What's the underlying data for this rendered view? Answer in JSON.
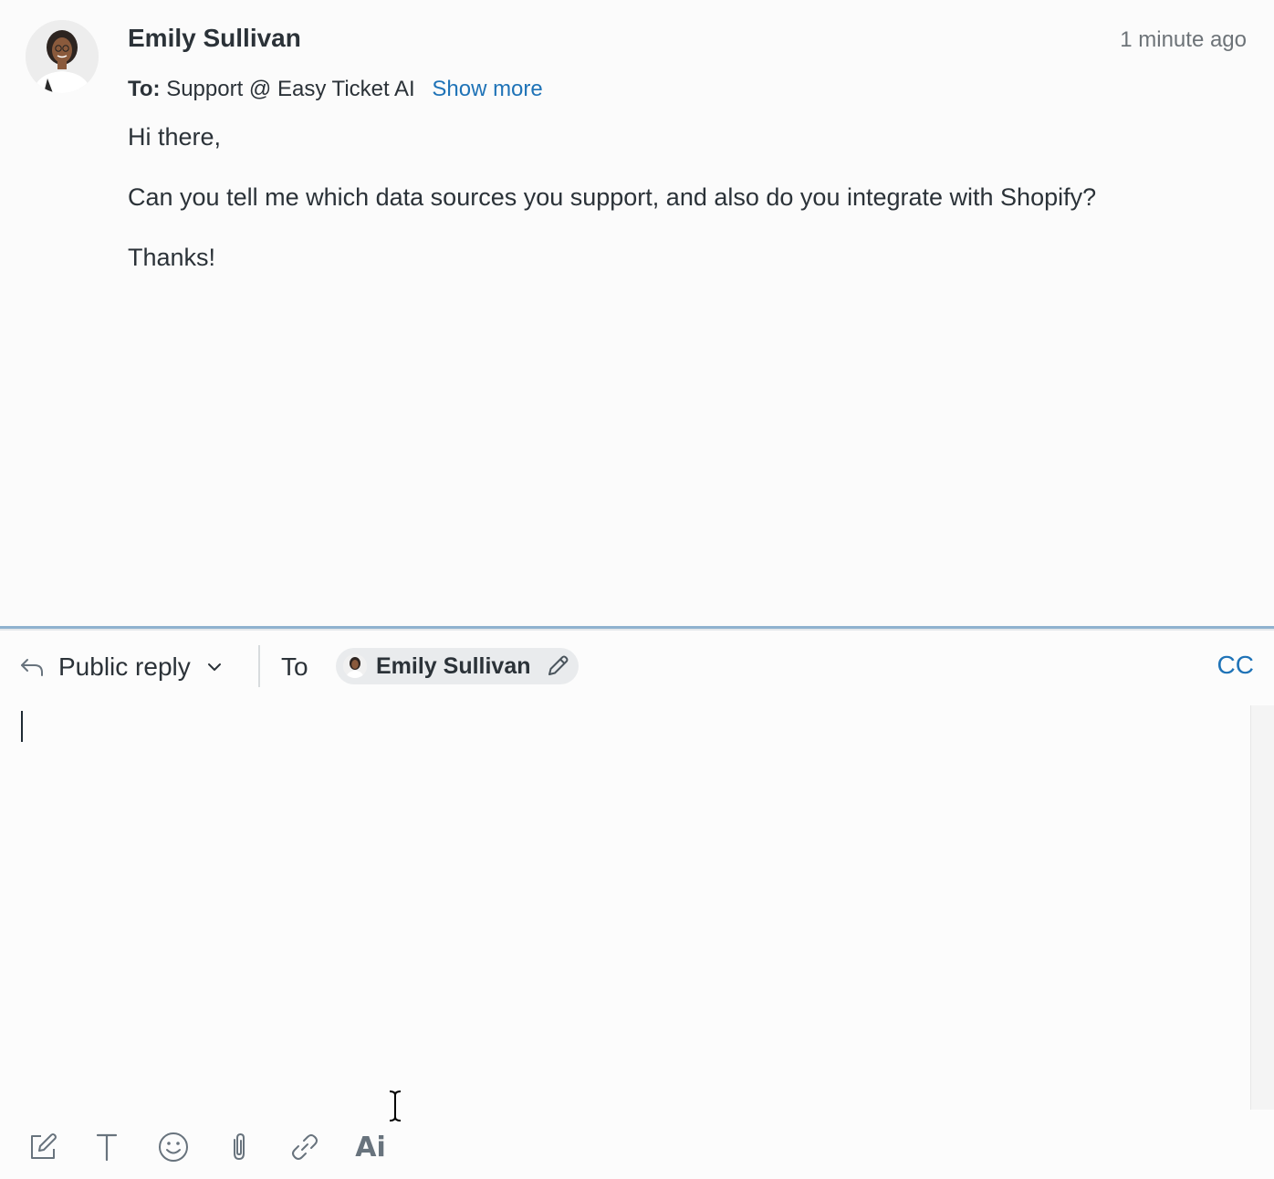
{
  "message": {
    "sender_name": "Emily Sullivan",
    "timestamp": "1 minute ago",
    "to_prefix": "To:",
    "to_value": "Support @ Easy Ticket AI",
    "show_more_label": "Show more",
    "paragraphs": [
      "Hi there,",
      "Can you tell me which data sources you support, and also do you integrate with Shopify?",
      "Thanks!"
    ]
  },
  "composer": {
    "reply_type_label": "Public reply",
    "to_label": "To",
    "recipient_name": "Emily Sullivan",
    "cc_label": "CC",
    "editor_value": ""
  },
  "toolbar": {
    "items": [
      "compose-icon",
      "text-format-icon",
      "emoji-icon",
      "attachment-icon",
      "link-icon",
      "ai-icon"
    ],
    "ai_label": "Ai"
  },
  "colors": {
    "link": "#1f73b7",
    "divider": "#8fb2cf",
    "icon": "#68737d"
  }
}
